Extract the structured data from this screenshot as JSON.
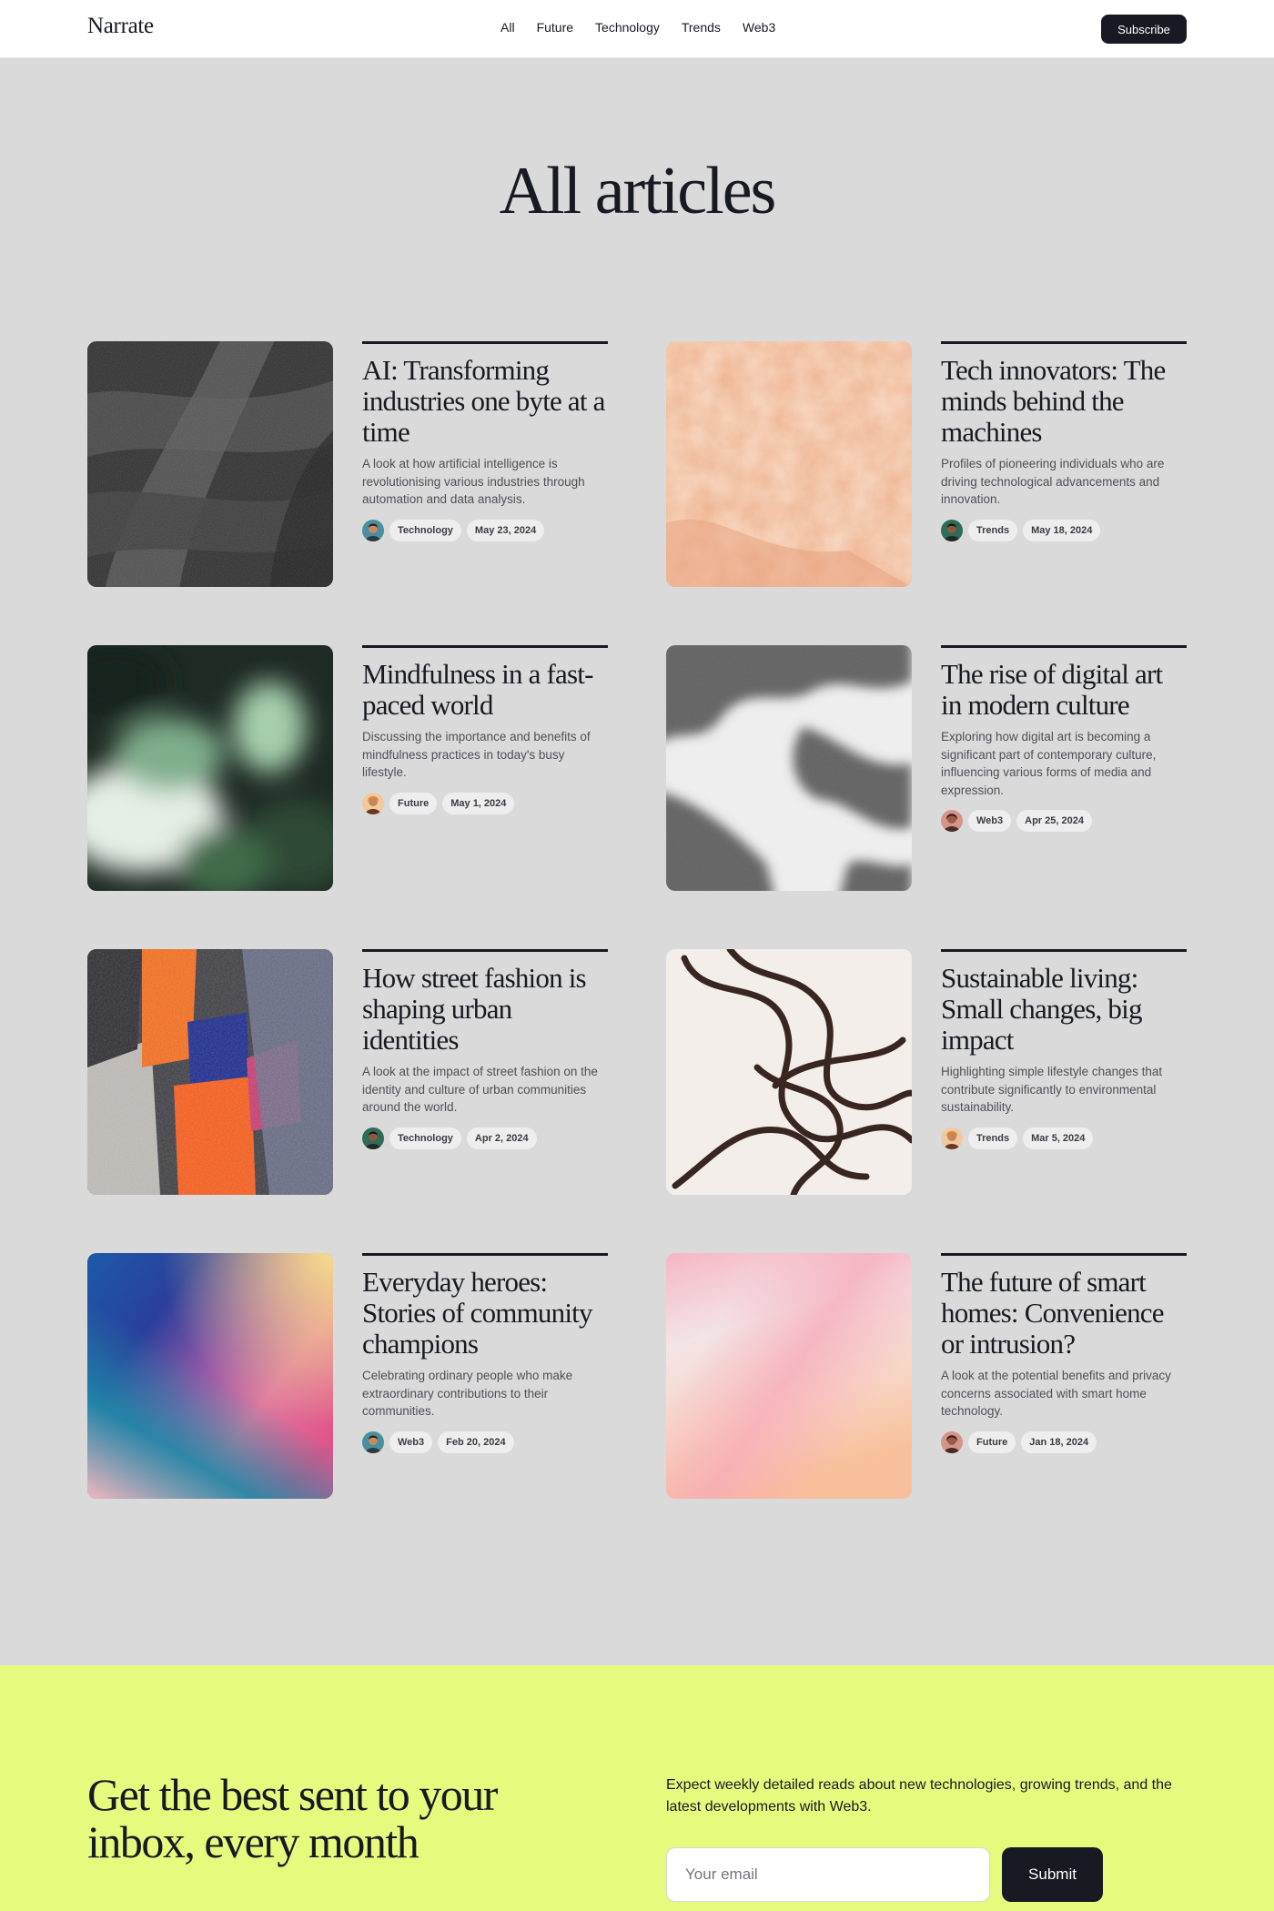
{
  "header": {
    "logo": "Narrate",
    "nav": [
      "All",
      "Future",
      "Technology",
      "Trends",
      "Web3"
    ],
    "subscribe": "Subscribe"
  },
  "page_title": "All articles",
  "articles": [
    {
      "title": "AI: Transforming industries one byte at a time",
      "description": "A look at how artificial intelligence is revolutionising various industries through automation and data analysis.",
      "category": "Technology",
      "date": "May 23, 2024",
      "image": "dark-brushstroke-texture",
      "avatar_color": "#4a8fa0"
    },
    {
      "title": "Tech innovators: The minds behind the machines",
      "description": "Profiles of pioneering individuals who are driving technological advancements and innovation.",
      "category": "Trends",
      "date": "May 18, 2024",
      "image": "peach-plaster-texture",
      "avatar_color": "#2f6a5a"
    },
    {
      "title": "Mindfulness in a fast-paced world",
      "description": "Discussing the importance and benefits of mindfulness practices in today's busy lifestyle.",
      "category": "Future",
      "date": "May 1, 2024",
      "image": "blurred-green-foliage",
      "avatar_color": "#d99048"
    },
    {
      "title": "The rise of digital art in modern culture",
      "description": "Exploring how digital art is becoming a significant part of contemporary culture, influencing various forms of media and expression.",
      "category": "Web3",
      "date": "Apr 25, 2024",
      "image": "grey-leaf-shadows",
      "avatar_color": "#b5605a"
    },
    {
      "title": "How street fashion is shaping urban identities",
      "description": "A look at the impact of street fashion on the identity and culture of urban communities around the world.",
      "category": "Technology",
      "date": "Apr 2, 2024",
      "image": "colorful-pastel-strokes",
      "avatar_color": "#2f6a5a"
    },
    {
      "title": "Sustainable living: Small changes, big impact",
      "description": "Highlighting simple lifestyle changes that contribute significantly to environmental sustainability.",
      "category": "Trends",
      "date": "Mar 5, 2024",
      "image": "brown-line-scribbles",
      "avatar_color": "#d99048"
    },
    {
      "title": "Everyday heroes: Stories of community champions",
      "description": "Celebrating ordinary people who make extraordinary contributions to their communities.",
      "category": "Web3",
      "date": "Feb 20, 2024",
      "image": "blue-pink-gradient",
      "avatar_color": "#4a8fa0"
    },
    {
      "title": "The future of smart homes: Convenience or intrusion?",
      "description": "A look at the potential benefits and privacy concerns associated with smart home technology.",
      "category": "Future",
      "date": "Jan 18, 2024",
      "image": "pink-peach-gradient",
      "avatar_color": "#b5605a"
    }
  ],
  "newsletter": {
    "title": "Get the best sent to your inbox, every month",
    "description": "Expect weekly detailed reads about new technologies, growing trends, and the latest developments with Web3.",
    "email_placeholder": "Your email",
    "submit": "Submit"
  },
  "colors": {
    "background": "#dadada",
    "ink": "#171a22",
    "newsletter_bg": "#e6fa7e"
  }
}
